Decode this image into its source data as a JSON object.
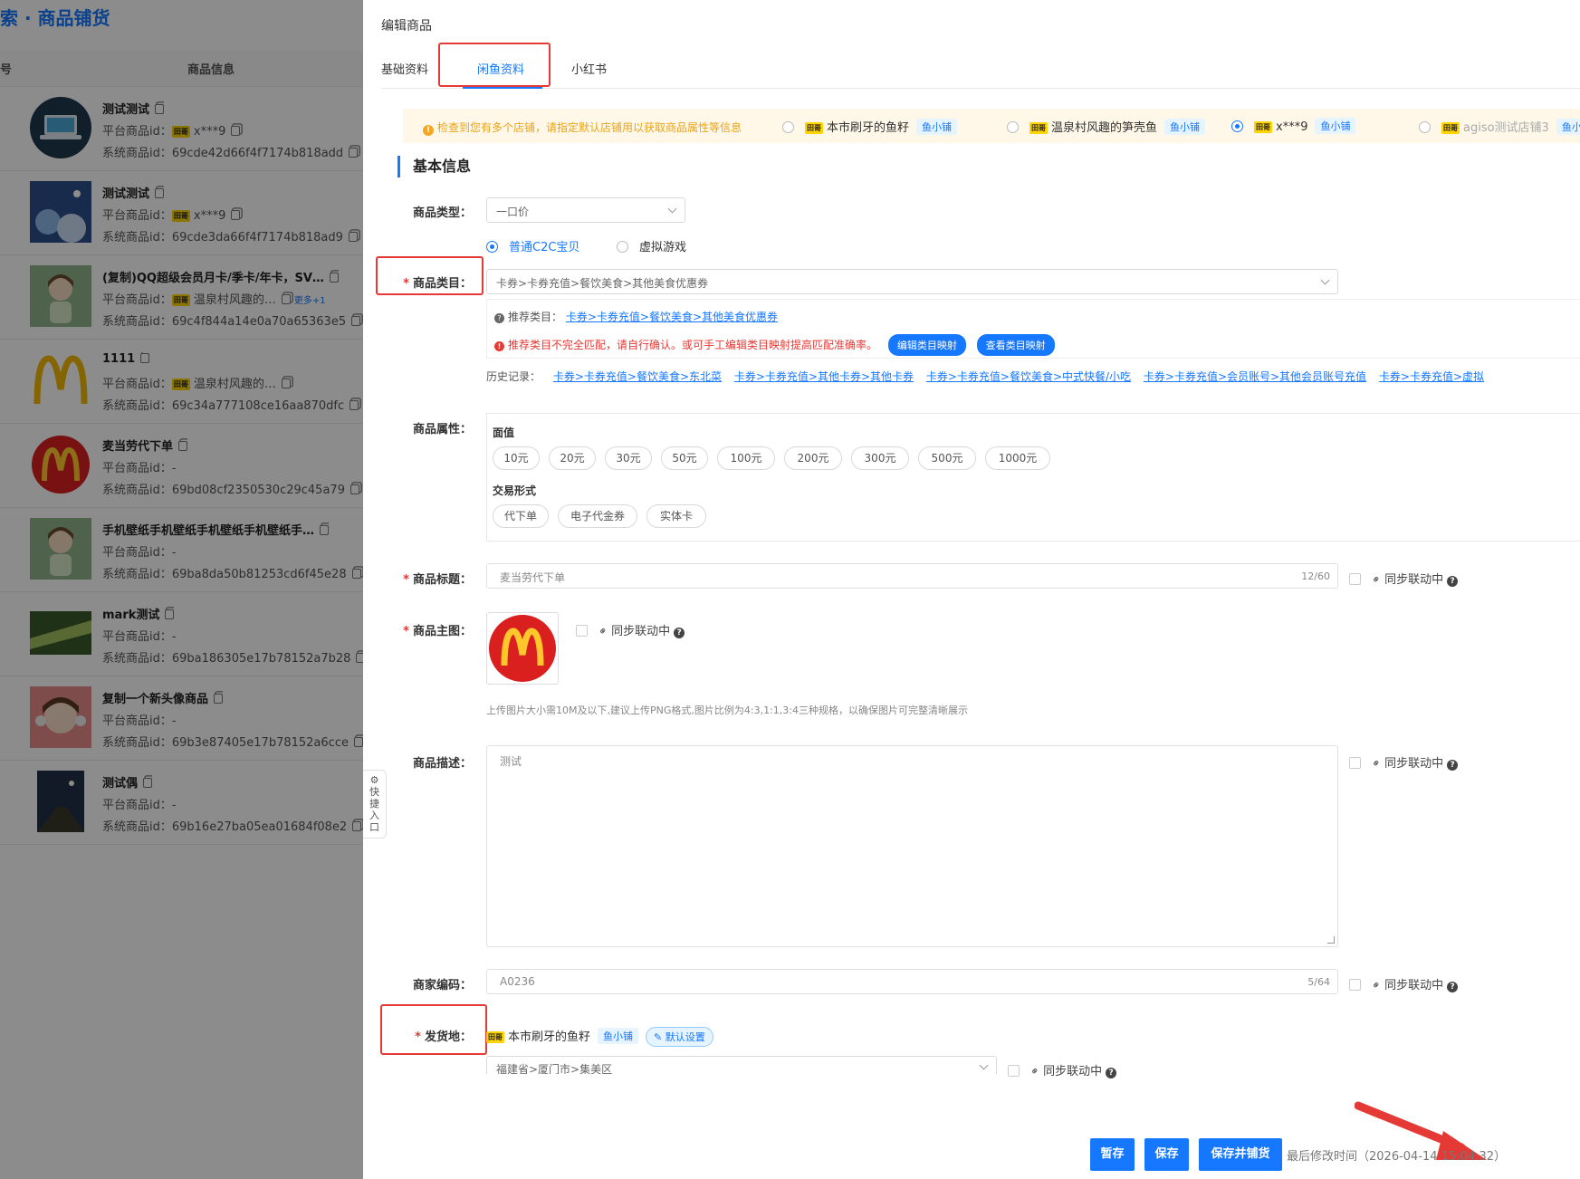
{
  "left": {
    "page_title": "索 · 商品铺货",
    "col_index": "号",
    "col_info": "商品信息",
    "platform_label": "平台商品id：",
    "system_label": "系统商品id：",
    "rows": [
      {
        "title": "测试测试",
        "platform": "x***9",
        "badge": true,
        "system": "69cde42d66f4f7174b818add",
        "more": ""
      },
      {
        "title": "测试测试",
        "platform": "x***9",
        "badge": true,
        "system": "69cde3da66f4f7174b818ad9",
        "more": ""
      },
      {
        "title": "(复制)QQ超级会员月卡/季卡/年卡，SV…",
        "platform": "温泉村风趣的…",
        "badge": true,
        "system": "69c4f844a14e0a70a65363e5",
        "more": "更多+1"
      },
      {
        "title": "1111",
        "platform": "温泉村风趣的…",
        "badge": true,
        "system": "69c34a777108ce16aa870dfc",
        "more": ""
      },
      {
        "title": "麦当劳代下单",
        "platform": "-",
        "badge": false,
        "system": "69bd08cf2350530c29c45a79",
        "more": ""
      },
      {
        "title": "手机壁纸手机壁纸手机壁纸手机壁纸手…",
        "platform": "-",
        "badge": false,
        "system": "69ba8da50b81253cd6f45e28",
        "more": ""
      },
      {
        "title": "mark测试",
        "platform": "-",
        "badge": false,
        "system": "69ba186305e17b78152a7b28",
        "more": ""
      },
      {
        "title": "复制一个新头像商品",
        "platform": "-",
        "badge": false,
        "system": "69b3e87405e17b78152a6cce",
        "more": ""
      },
      {
        "title": "测试偶",
        "platform": "-",
        "badge": false,
        "system": "69b16e27ba05ea01684f08e2",
        "more": ""
      }
    ]
  },
  "drawer": {
    "title": "编辑商品",
    "tabs": [
      "基础资料",
      "闲鱼资料",
      "小红书"
    ],
    "notice": "检查到您有多个店铺，请指定默认店铺用以获取商品属性等信息",
    "shop_badge": "田哥",
    "stores": [
      {
        "name": "本市刷牙的鱼籽",
        "tag": "鱼小铺",
        "selected": false,
        "faded": false
      },
      {
        "name": "温泉村风趣的笋壳鱼",
        "tag": "鱼小铺",
        "selected": false,
        "faded": false
      },
      {
        "name": "x***9",
        "tag": "鱼小铺",
        "selected": true,
        "faded": false
      },
      {
        "name": "agiso测试店铺3",
        "tag": "鱼小",
        "selected": false,
        "faded": true
      }
    ],
    "section_title": "基本信息",
    "labels": {
      "type": "商品类型：",
      "category": "商品类目：",
      "attributes": "商品属性：",
      "title": "商品标题：",
      "main_image": "商品主图：",
      "description": "商品描述：",
      "code": "商家编码：",
      "ship_from": "发货地："
    },
    "type_value": "一口价",
    "type_radios": [
      "普通C2C宝贝",
      "虚拟游戏"
    ],
    "category_value": "卡券>卡券充值>餐饮美食>其他美食优惠券",
    "recommend_label": "推荐类目：",
    "recommend_value": "卡券>卡券充值>餐饮美食>其他美食优惠券",
    "mismatch_warning": "推荐类目不完全匹配，请自行确认。或可手工编辑类目映射提高匹配准确率。",
    "btn_edit_mapping": "编辑类目映射",
    "btn_view_mapping": "查看类目映射",
    "history_label": "历史记录：",
    "history": [
      "卡券>卡券充值>餐饮美食>东北菜",
      "卡券>卡券充值>其他卡券>其他卡券",
      "卡券>卡券充值>餐饮美食>中式快餐/小吃",
      "卡券>卡券充值>会员账号>其他会员账号充值",
      "卡券>卡券充值>虚拟"
    ],
    "attr_face_label": "面值",
    "attr_face": [
      "10元",
      "20元",
      "30元",
      "50元",
      "100元",
      "200元",
      "300元",
      "500元",
      "1000元"
    ],
    "attr_trade_label": "交易形式",
    "attr_trade": [
      "代下单",
      "电子代金券",
      "实体卡"
    ],
    "title_value": "麦当劳代下单",
    "title_count": "12/60",
    "sync_label": "同步联动中",
    "image_hint": "上传图片大小需10M及以下,建议上传PNG格式,图片比例为4:3,1:1,3:4三种规格，以确保图片可完整清晰展示",
    "description_value": "测试",
    "code_value": "A0236",
    "code_count": "5/64",
    "ship_store": "本市刷牙的鱼籽",
    "ship_tag": "鱼小铺",
    "ship_default": "默认设置",
    "ship_region": "福建省>厦门市>集美区",
    "side_tab": "快捷入口",
    "footer": {
      "save_draft": "暂存",
      "save": "保存",
      "save_and_list": "保存并铺货",
      "last_modified": "最后修改时间（2026-04-14 15:04:32）"
    }
  },
  "colors": {
    "primary": "#1677ff",
    "highlight": "#e53935",
    "warning": "#e8a317"
  }
}
